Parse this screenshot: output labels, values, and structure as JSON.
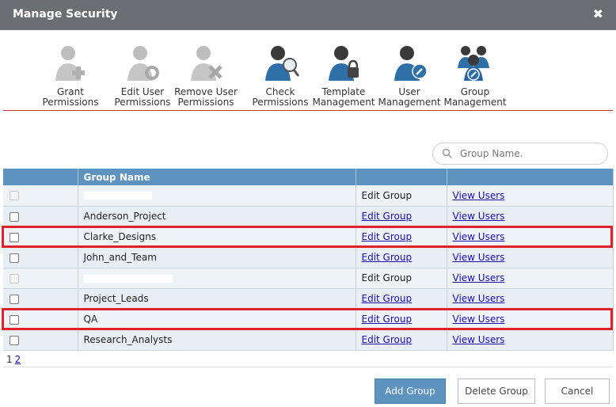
{
  "window": {
    "title": "Manage Security",
    "close_glyph": "✖"
  },
  "toolbar": {
    "items": [
      {
        "label": "Grant\nPermissions",
        "icon": "grant-permissions-icon"
      },
      {
        "label": "Edit User\nPermissions",
        "icon": "edit-user-permissions-icon"
      },
      {
        "label": "Remove User\nPermissions",
        "icon": "remove-user-permissions-icon"
      },
      {
        "label": "Check\nPermissions",
        "icon": "check-permissions-icon"
      },
      {
        "label": "Template\nManagement",
        "icon": "template-management-icon"
      },
      {
        "label": "User\nManagement",
        "icon": "user-management-icon"
      },
      {
        "label": "Group\nManagement",
        "icon": "group-management-icon"
      }
    ]
  },
  "search": {
    "placeholder": "Group Name.",
    "value": ""
  },
  "table": {
    "headers": [
      "",
      "Group Name",
      "",
      ""
    ],
    "rows": [
      {
        "name": "",
        "edit": "Edit Group",
        "view": "View Users",
        "edit_link": false,
        "disabled": true,
        "redacted": true
      },
      {
        "name": "Anderson_Project",
        "edit": "Edit Group",
        "view": "View Users",
        "edit_link": true,
        "disabled": false,
        "redacted": false,
        "highlighted": true
      },
      {
        "name": "Clarke_Designs",
        "edit": "Edit Group",
        "view": "View Users",
        "edit_link": true,
        "disabled": false,
        "redacted": false
      },
      {
        "name": "John_and_Team",
        "edit": "Edit Group",
        "view": "View Users",
        "edit_link": true,
        "disabled": false,
        "redacted": false
      },
      {
        "name": "",
        "edit": "Edit Group",
        "view": "View Users",
        "edit_link": false,
        "disabled": true,
        "redacted": true
      },
      {
        "name": "Project_Leads",
        "edit": "Edit Group",
        "view": "View Users",
        "edit_link": true,
        "disabled": false,
        "redacted": false,
        "highlighted": true
      },
      {
        "name": "QA",
        "edit": "Edit Group",
        "view": "View Users",
        "edit_link": true,
        "disabled": false,
        "redacted": false
      },
      {
        "name": "Research_Analysts",
        "edit": "Edit Group",
        "view": "View Users",
        "edit_link": true,
        "disabled": false,
        "redacted": false
      }
    ]
  },
  "pager": {
    "current": "1",
    "pages": [
      "2"
    ]
  },
  "buttons": {
    "add": "Add Group",
    "delete": "Delete Group",
    "cancel": "Cancel"
  },
  "colors": {
    "header_blue": "#5f93bf",
    "highlight_red": "#e0202a",
    "titlebar_gray": "#6b6e72"
  }
}
